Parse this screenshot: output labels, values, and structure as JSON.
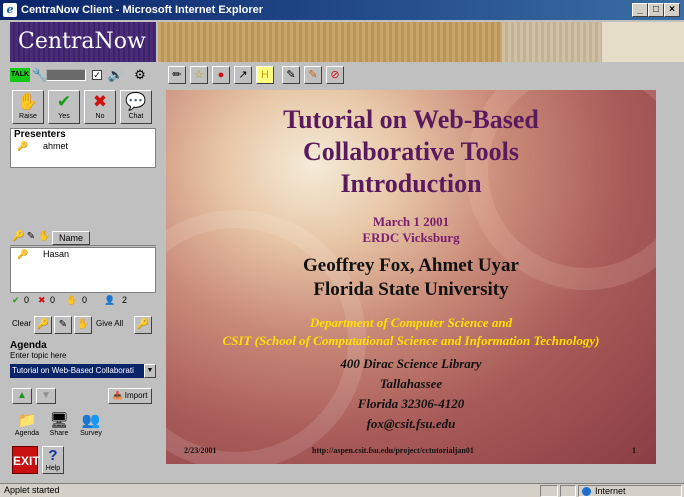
{
  "window": {
    "title": "CentraNow Client - Microsoft Internet Explorer",
    "min_glyph": "_",
    "max_glyph": "□",
    "close_glyph": "×"
  },
  "brand": {
    "name": "CentraNow"
  },
  "audio": {
    "talk_label": "TALK",
    "checkbox_mark": "✓"
  },
  "actions": [
    {
      "label": "Raise",
      "icon": "hand-icon"
    },
    {
      "label": "Yes",
      "icon": "checkmark-icon"
    },
    {
      "label": "No",
      "icon": "x-icon"
    },
    {
      "label": "Chat",
      "icon": "chat-icon"
    }
  ],
  "presenters": {
    "header": "Presenters",
    "names": [
      "ahmet"
    ]
  },
  "attendees": {
    "name_col": "Name",
    "names": [
      "Hasan"
    ]
  },
  "counts": {
    "yes": "0",
    "no": "0",
    "hand": "0",
    "people": "2"
  },
  "clear": {
    "clear_label": "Clear",
    "give_all_label": "Give All"
  },
  "agenda": {
    "header": "Agenda",
    "prompt": "Enter topic here",
    "selected": "Tutorial on Web-Based Collaborati",
    "import_label": "Import"
  },
  "bottom_buttons": [
    {
      "label": "Agenda"
    },
    {
      "label": "Share"
    },
    {
      "label": "Survey"
    }
  ],
  "exit_label": "EXIT",
  "help_label": "Help",
  "slide": {
    "title_lines": [
      "Tutorial on Web-Based",
      "Collaborative Tools",
      "Introduction"
    ],
    "date": "March 1 2001",
    "place": "ERDC Vicksburg",
    "authors": "Geoffrey Fox, Ahmet Uyar",
    "university": "Florida State University",
    "dept": "Department of Computer Science and",
    "csit": "CSIT (School of Computational Science and Information Technology)",
    "address": [
      "400 Dirac Science Library",
      "Tallahassee",
      "Florida 32306-4120",
      "fox@csit.fsu.edu"
    ],
    "footer_date": "2/23/2001",
    "footer_url": "http://aspen.csit.fsu.edu/project/cctutorialjan01",
    "footer_page": "1"
  },
  "status": {
    "text": "Applet started",
    "zone": "Internet"
  }
}
